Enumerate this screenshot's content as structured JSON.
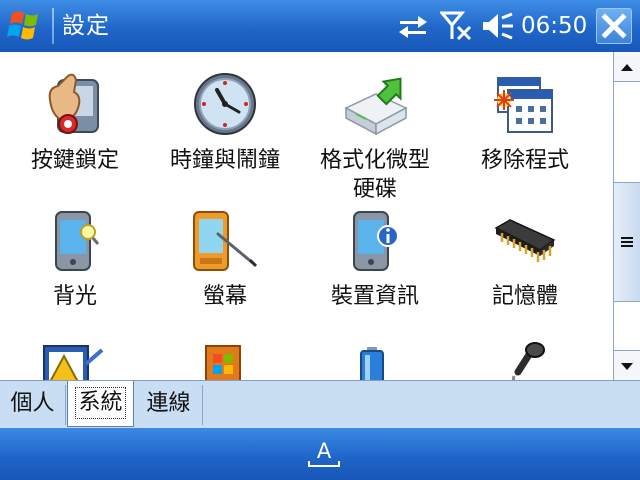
{
  "titlebar": {
    "title": "設定",
    "clock": "06:50",
    "icons": [
      "windows-start-icon",
      "sync-arrows-icon",
      "signal-off-icon",
      "speaker-icon",
      "close-icon"
    ]
  },
  "grid": {
    "items": [
      {
        "label": "按鍵鎖定",
        "icon": "key-lock-icon"
      },
      {
        "label": "時鐘與鬧鐘",
        "icon": "clock-icon"
      },
      {
        "label": "格式化微型\n硬碟",
        "label_line1": "格式化微型",
        "label_line2": "硬碟",
        "icon": "format-disk-icon"
      },
      {
        "label": "移除程式",
        "icon": "remove-programs-icon"
      },
      {
        "label": "背光",
        "icon": "backlight-icon"
      },
      {
        "label": "螢幕",
        "icon": "screen-icon"
      },
      {
        "label": "裝置資訊",
        "icon": "device-info-icon"
      },
      {
        "label": "記憶體",
        "icon": "memory-icon"
      }
    ],
    "partial_icons": [
      "error-report-icon",
      "windows-update-icon",
      "battery-icon",
      "microphone-icon"
    ]
  },
  "tabs": [
    {
      "label": "個人",
      "active": false
    },
    {
      "label": "系統",
      "active": true
    },
    {
      "label": "連線",
      "active": false
    }
  ],
  "menubar": {
    "sip_label": "A"
  },
  "colors": {
    "bar_blue": "#1f66c9",
    "tab_strip": "#c9ddf3"
  }
}
